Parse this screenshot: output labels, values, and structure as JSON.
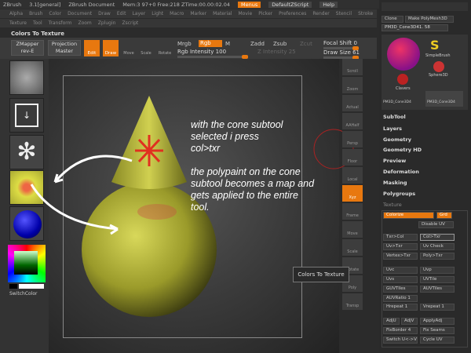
{
  "titlebar": {
    "app": "ZBrush",
    "version": "3.1[general]",
    "document": "ZBrush Document",
    "mem": "Mem:3 97+0 Free:218 ZTime:00.00:02.04",
    "menus_btn": "Menus",
    "script": "DefaultZScript",
    "help": "Help"
  },
  "menu_row1": [
    "Alpha",
    "Brush",
    "Color",
    "Document",
    "Draw",
    "Edit",
    "Layer",
    "Light",
    "Macro",
    "Marker",
    "Material",
    "Movie",
    "Picker",
    "Preferences",
    "Render",
    "Stencil",
    "Stroke"
  ],
  "menu_row2": [
    "Texture",
    "Tool",
    "Transform",
    "Zoom",
    "Zplugin",
    "Zscript"
  ],
  "palette_title": "Colors To Texture",
  "toolbar": {
    "zmapper": "ZMapper",
    "zmapper_rev": "rev-E",
    "projection": "Projection",
    "master": "Master",
    "edit": "Edit",
    "draw": "Draw",
    "move": "Move",
    "scale": "Scale",
    "rotate": "Rotate",
    "mrgb": "Mrgb",
    "rgb": "Rgb",
    "m": "M",
    "rgb_intensity": "Rgb Intensity 100",
    "zadd": "Zadd",
    "zsub": "Zsub",
    "zcut": "Zcut",
    "z_intensity": "Z Intensity 25",
    "focal_shift": "Focal Shift 0",
    "draw_size": "Draw Size 61"
  },
  "left_shelf": {
    "switch_color": "SwitchColor"
  },
  "annotation": {
    "line1": "with the cone subtool",
    "line2": "selected i press",
    "line3": "col>txr",
    "line4": "the polypaint on the cone",
    "line5": "subtool becomes a map and",
    "line6": "gets applied to the entire",
    "line7": "tool."
  },
  "tooltip": "Colors To Texture",
  "right_icons": [
    "Scroll",
    "Zoom",
    "Actual",
    "AAHalf",
    "Persp",
    "Floor",
    "Local",
    "Xyz",
    "Frame",
    "Move",
    "Scale",
    "Rotate",
    "Poly",
    "Transp"
  ],
  "right_panel": {
    "clone": "Clone",
    "make_polymesh": "Make PolyMesh3D",
    "tool_name": "PM3D_Cone3D41. 58",
    "tools": [
      "SimpleBrush",
      "Sphere3D",
      "Clavers",
      "PM3D_Cone3D4",
      "PM3D_Cone3D4"
    ],
    "sections": [
      "SubTool",
      "Layers",
      "Geometry",
      "Geometry HD",
      "Preview",
      "Deformation",
      "Masking",
      "Polygroups",
      "Texture"
    ],
    "texture": {
      "colorize": "Colorize",
      "grd": "Grd",
      "disable_uv": "Disable UV",
      "txr_col": "Txr>Col",
      "col_txr": "Col>Txr",
      "uv_txr": "Uv>Txr",
      "uv_check": "Uv Check",
      "vertex_txr": "Vertex>Txr",
      "poly_txr": "Poly>Txr",
      "uvc": "Uvc",
      "uvp": "Uvp",
      "uvs": "Uvs",
      "uvtile": "UVTile",
      "guvtiles": "GUVTiles",
      "auvtiles": "AUVTiles",
      "auvratio": "AUVRatio 1",
      "hrepeat": "Hrepeat 1",
      "vrepeat": "Vrepeat 1",
      "adju": "AdjU",
      "adjv": "AdjV",
      "applyadj": "ApplyAdj",
      "fixborder": "FixBorder 4",
      "fix_seams": "Fix Seams",
      "switch_uv": "Switch U<->V",
      "cycle_uv": "Cycle UV"
    }
  },
  "colors": {
    "accent": "#e8780f",
    "panel": "#2a2a2a"
  }
}
